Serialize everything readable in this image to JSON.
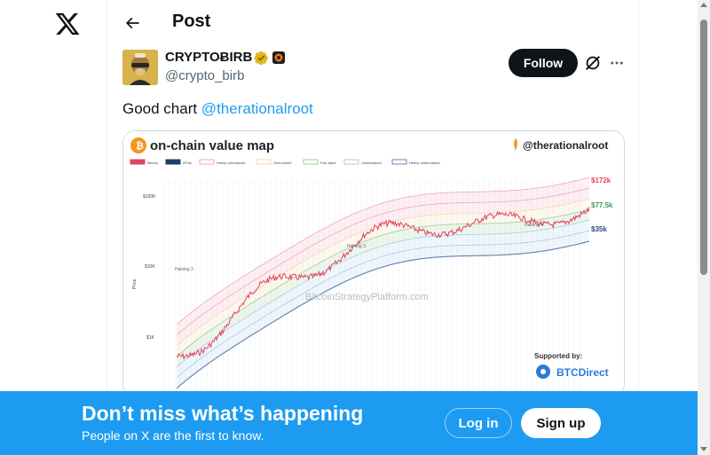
{
  "nav": {
    "logo_icon": "x-logo-icon"
  },
  "header": {
    "title": "Post",
    "back_icon": "arrow-left-icon"
  },
  "tweet": {
    "author_name": "CRYPTOɃIRB",
    "handle": "@crypto_birb",
    "verified_color": "#e2b719",
    "follow_label": "Follow",
    "text": "Good chart ",
    "mention": "@therationalroot"
  },
  "media": {
    "title": "on-chain value map",
    "credit": "@therationalroot",
    "legend": [
      "Bitcoin",
      "ATHs",
      "Heavy overvalued",
      "Overvalued",
      "Fair value",
      "Undervalued",
      "Heavy undervalued"
    ],
    "price_labels": [
      "$172k",
      "$77.5k",
      "$35k"
    ],
    "y_ticks": [
      "$100K",
      "$10K",
      "$1K"
    ],
    "y_axis_label": "Price",
    "annotations": [
      "Halving 2",
      "Halving 3",
      "Halving 4"
    ],
    "watermark": "BitcoinStrategyPlatform.com",
    "supported_by": "Supported by:",
    "sponsor": "BTCDirect",
    "colors": {
      "bitcoin": "#e0445e",
      "aths": "#1f3c6b",
      "heavy_overvalued": "#f4a7b6",
      "overvalued": "#f6d8a8",
      "fair_value": "#9ccf8f",
      "undervalued": "#a9cbe8",
      "heavy_undervalued": "#6e86b5"
    }
  },
  "banner": {
    "title": "Don’t miss what’s happening",
    "subtitle": "People on X are the first to know.",
    "login_label": "Log in",
    "signup_label": "Sign up",
    "bg": "#1d9bf0"
  }
}
